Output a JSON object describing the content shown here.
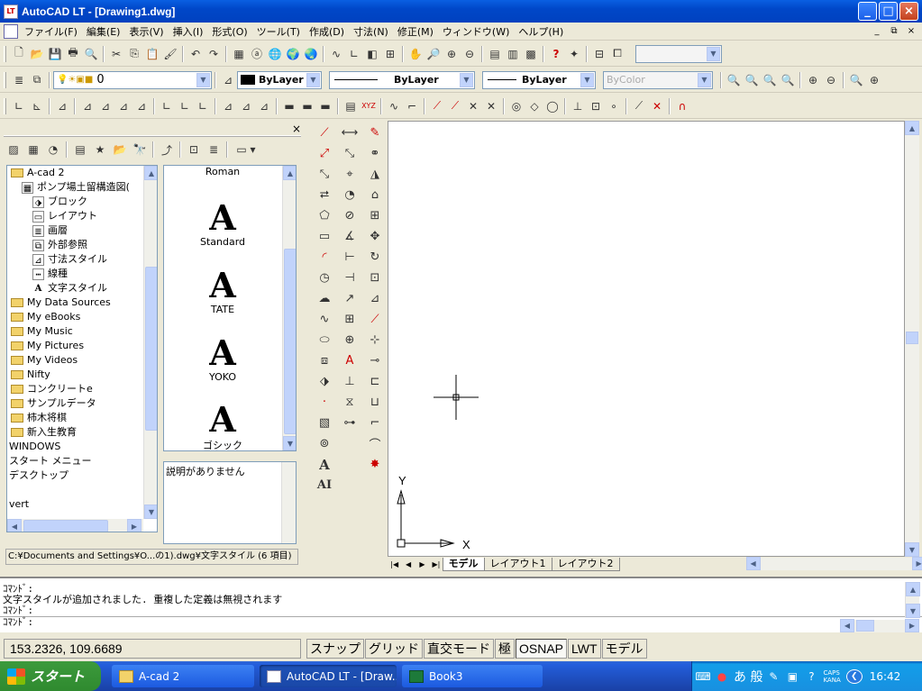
{
  "window": {
    "title": "AutoCAD LT - [Drawing1.dwg]",
    "buttons": [
      "_",
      "□",
      "×"
    ]
  },
  "menubar": {
    "items": [
      "ファイル(F)",
      "編集(E)",
      "表示(V)",
      "挿入(I)",
      "形式(O)",
      "ツール(T)",
      "作成(D)",
      "寸法(N)",
      "修正(M)",
      "ウィンドウ(W)",
      "ヘルプ(H)"
    ],
    "mdi_buttons": [
      "_",
      "⧉",
      "×"
    ]
  },
  "layers_toolbar": {
    "layer_value": "0",
    "color_value": "ByLayer",
    "linetype_value": "ByLayer",
    "lineweight_value": "ByLayer",
    "plotstyle_value": "ByColor"
  },
  "design_center": {
    "close": "×",
    "tree": [
      {
        "label": "A-cad 2",
        "icon": "folder",
        "indent": 0
      },
      {
        "label": "ポンプ場土留構造図(",
        "icon": "drawing",
        "indent": 1
      },
      {
        "label": "ブロック",
        "icon": "block",
        "indent": 2
      },
      {
        "label": "レイアウト",
        "icon": "layout",
        "indent": 2
      },
      {
        "label": "画層",
        "icon": "layer",
        "indent": 2
      },
      {
        "label": "外部参照",
        "icon": "xref",
        "indent": 2
      },
      {
        "label": "寸法スタイル",
        "icon": "dimstyle",
        "indent": 2
      },
      {
        "label": "線種",
        "icon": "linetype",
        "indent": 2
      },
      {
        "label": "文字スタイル",
        "icon": "textstyle",
        "indent": 2
      },
      {
        "label": "My Data Sources",
        "icon": "folder",
        "indent": 0
      },
      {
        "label": "My eBooks",
        "icon": "folder",
        "indent": 0
      },
      {
        "label": "My Music",
        "icon": "folder",
        "indent": 0
      },
      {
        "label": "My Pictures",
        "icon": "folder",
        "indent": 0
      },
      {
        "label": "My Videos",
        "icon": "folder",
        "indent": 0
      },
      {
        "label": "Nifty",
        "icon": "folder",
        "indent": 0
      },
      {
        "label": "コンクリートe",
        "icon": "folder",
        "indent": 0
      },
      {
        "label": "サンプルデータ",
        "icon": "folder",
        "indent": 0
      },
      {
        "label": "柿木将棋",
        "icon": "folder",
        "indent": 0
      },
      {
        "label": "新入生教育",
        "icon": "folder",
        "indent": 0
      },
      {
        "label": "WINDOWS",
        "icon": "none",
        "indent": 0
      },
      {
        "label": "スタート メニュー",
        "icon": "none",
        "indent": 0
      },
      {
        "label": "デスクトップ",
        "icon": "none",
        "indent": 0
      },
      {
        "label": "",
        "icon": "none",
        "indent": 0
      },
      {
        "label": "vert",
        "icon": "none",
        "indent": 0
      }
    ],
    "styles": [
      {
        "label": "Roman",
        "glyph": ""
      },
      {
        "label": "Standard",
        "glyph": "A"
      },
      {
        "label": "TATE",
        "glyph": "A"
      },
      {
        "label": "YOKO",
        "glyph": "A"
      },
      {
        "label": "ゴシック",
        "glyph": "A"
      }
    ],
    "description": "説明がありません",
    "status_path": "C:¥Documents and Settings¥O...の1).dwg¥文字スタイル (6 項目)"
  },
  "drawing": {
    "ucs_y": "Y",
    "ucs_x": "X",
    "tabs": [
      "モデル",
      "レイアウト1",
      "レイアウト2"
    ],
    "active_tab": "モデル"
  },
  "command_line": {
    "lines": [
      "ｺﾏﾝﾄﾞ:",
      "文字スタイルが追加されました. 重複した定義は無視されます",
      "ｺﾏﾝﾄﾞ:",
      "ｺﾏﾝﾄﾞ:"
    ]
  },
  "statusbar": {
    "coordinates": "153.2326, 109.6689",
    "toggles": [
      {
        "label": "スナップ",
        "on": false
      },
      {
        "label": "グリッド",
        "on": false
      },
      {
        "label": "直交モード",
        "on": false
      },
      {
        "label": "極",
        "on": false
      },
      {
        "label": "OSNAP",
        "on": true
      },
      {
        "label": "LWT",
        "on": false
      },
      {
        "label": "モデル",
        "on": false
      }
    ]
  },
  "taskbar": {
    "start_label": "スタート",
    "tasks": [
      {
        "label": "A-cad 2",
        "active": false
      },
      {
        "label": "AutoCAD LT - [Draw...",
        "active": true
      },
      {
        "label": "Book3",
        "active": false
      }
    ],
    "tray": {
      "ime_mode": "あ 般",
      "caps": "CAPS",
      "kana": "KANA",
      "clock": "16:42"
    }
  }
}
